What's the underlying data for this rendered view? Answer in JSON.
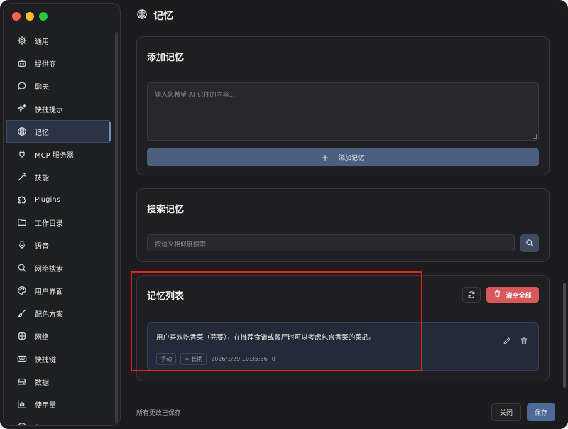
{
  "window": {
    "traffic_lights": [
      "close",
      "minimize",
      "maximize"
    ]
  },
  "sidebar": {
    "items": [
      {
        "label": "通用",
        "icon": "gear-icon"
      },
      {
        "label": "提供商",
        "icon": "bot-icon"
      },
      {
        "label": "聊天",
        "icon": "chat-bubble-icon"
      },
      {
        "label": "快捷提示",
        "icon": "sparkles-icon"
      },
      {
        "label": "记忆",
        "icon": "brain-icon",
        "active": true
      },
      {
        "label": "MCP 服务器",
        "icon": "plug-icon"
      },
      {
        "label": "技能",
        "icon": "magic-wand-icon"
      },
      {
        "label": "Plugins",
        "icon": "puzzle-icon"
      },
      {
        "label": "工作目录",
        "icon": "folder-icon"
      },
      {
        "label": "语音",
        "icon": "microphone-icon"
      },
      {
        "label": "网络搜索",
        "icon": "search-icon"
      },
      {
        "label": "用户界面",
        "icon": "palette-icon"
      },
      {
        "label": "配色方案",
        "icon": "brush-icon"
      },
      {
        "label": "网络",
        "icon": "globe-icon"
      },
      {
        "label": "快捷键",
        "icon": "keyboard-icon"
      },
      {
        "label": "数据",
        "icon": "drive-icon"
      },
      {
        "label": "使用量",
        "icon": "bar-chart-icon"
      },
      {
        "label": "关于",
        "icon": "info-icon"
      }
    ]
  },
  "header": {
    "title": "记忆",
    "icon": "brain-icon"
  },
  "add_memory": {
    "title": "添加记忆",
    "placeholder": "输入您希望 AI 记住的内容...",
    "button_label": "添加记忆"
  },
  "search_memory": {
    "title": "搜索记忆",
    "placeholder": "按语义相似度搜索..."
  },
  "memory_list": {
    "title": "记忆列表",
    "clear_all_label": "清空全部",
    "items": [
      {
        "text": "用户喜欢吃香菜（芫荽），在推荐食谱或餐厅时可以考虑包含香菜的菜品。",
        "source": "手动",
        "duration": "长期",
        "timestamp": "2026/1/29 10:35:56",
        "count": "0"
      }
    ]
  },
  "footer": {
    "status": "所有更改已保存",
    "close_label": "关闭",
    "save_label": "保存"
  },
  "colors": {
    "danger": "#d9595b",
    "primary": "#4c6a96",
    "annotation": "#e0251b"
  }
}
